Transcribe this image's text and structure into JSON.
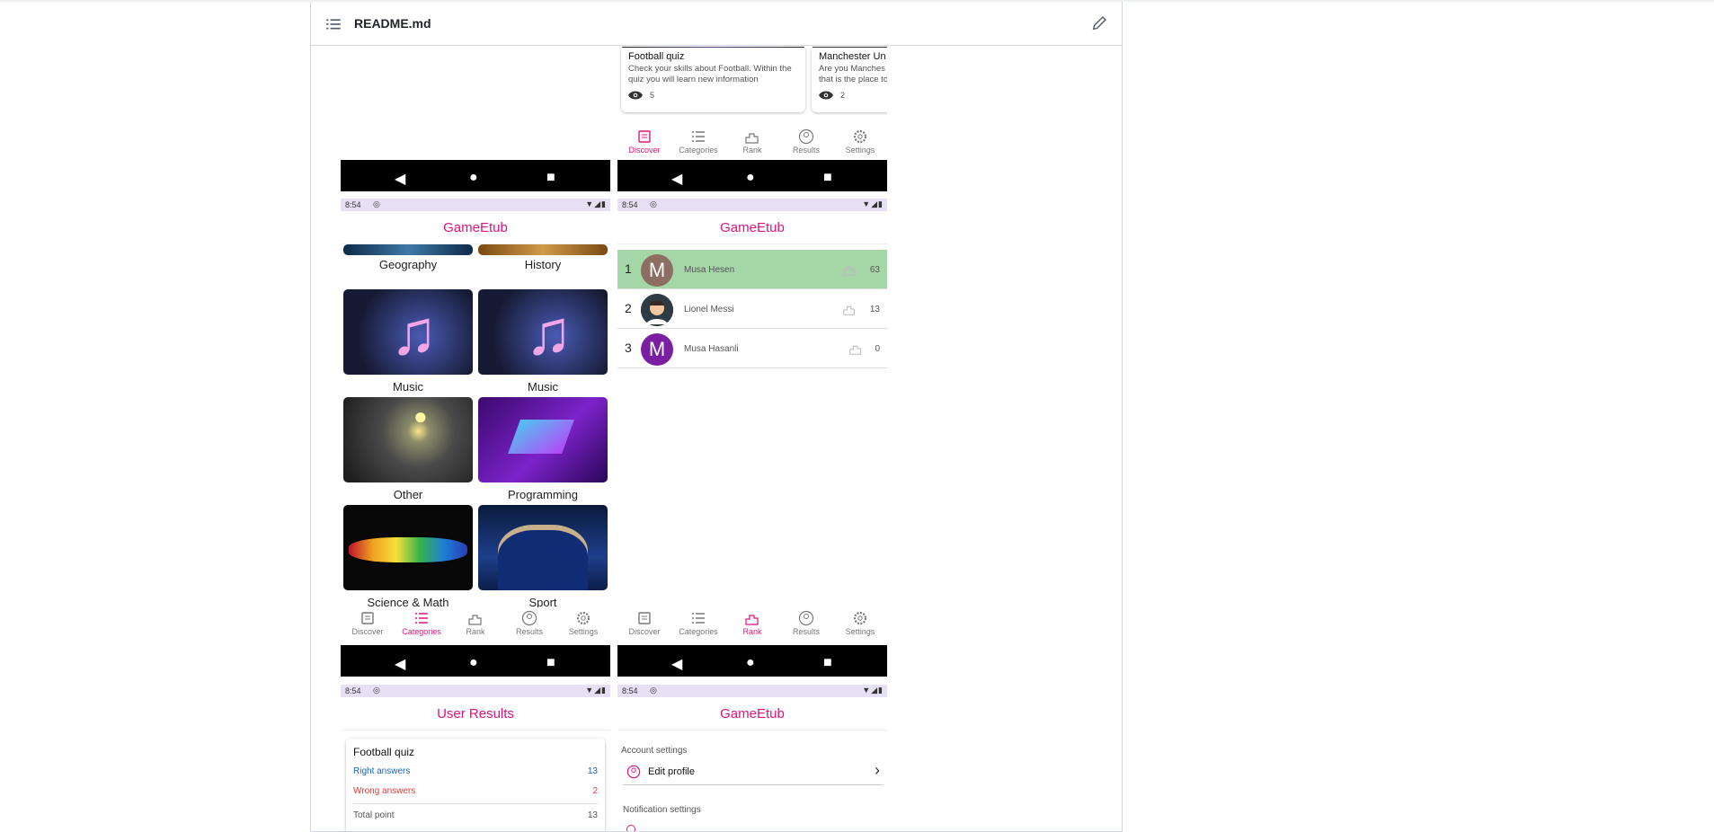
{
  "readme": {
    "file_name": "README.md"
  },
  "status_bar": {
    "time": "8:54"
  },
  "app_titles": {
    "gameetub": "GameEtub",
    "user_results": "User Results"
  },
  "bottom_nav": {
    "discover": "Discover",
    "categories": "Categories",
    "rank": "Rank",
    "results": "Results",
    "settings": "Settings"
  },
  "discover": {
    "cards": [
      {
        "title": "Football quiz",
        "description": "Check your skills about Football. Within the quiz you will learn new information",
        "views": "5"
      },
      {
        "title": "Manchester Un",
        "description": "Are you Manches that is the place to",
        "views": "2"
      }
    ]
  },
  "categories": {
    "items": [
      "Geography",
      "History",
      "Music",
      "Music",
      "Other",
      "Programming",
      "Science & Math",
      "Sport"
    ]
  },
  "rank": {
    "rows": [
      {
        "position": "1",
        "initial": "M",
        "name": "Musa Hesen",
        "points": "63",
        "highlight": true,
        "avatar_color": "#8d6e63"
      },
      {
        "position": "2",
        "initial": "",
        "name": "Lionel Messi",
        "points": "13",
        "highlight": false,
        "avatar_color": "#37474f"
      },
      {
        "position": "3",
        "initial": "M",
        "name": "Musa Hasanli",
        "points": "0",
        "highlight": false,
        "avatar_color": "#7b1fa2"
      }
    ]
  },
  "results": {
    "quiz_title": "Football quiz",
    "right_label": "Right answers",
    "right_value": "13",
    "wrong_label": "Wrong answers",
    "wrong_value": "2",
    "total_label": "Total point",
    "total_value": "13"
  },
  "settings": {
    "account_section": "Account settings",
    "edit_profile": "Edit profile",
    "notification_section": "Notification settings"
  },
  "colors": {
    "accent": "#e0137a",
    "highlight_row": "#a5d6a7",
    "status_bar": "#e7dff4",
    "right": "#1565c0",
    "wrong": "#e53935"
  }
}
